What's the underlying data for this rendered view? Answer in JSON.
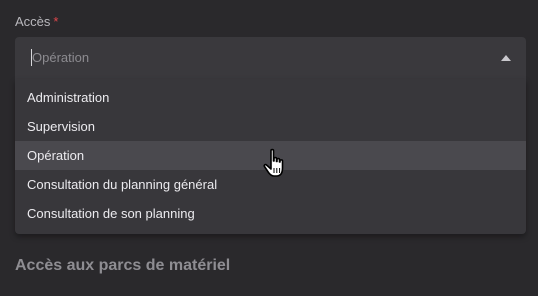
{
  "field": {
    "label": "Accès",
    "required_mark": "*",
    "placeholder": "Opération"
  },
  "dropdown": {
    "options": [
      {
        "label": "Administration"
      },
      {
        "label": "Supervision"
      },
      {
        "label": "Opération"
      },
      {
        "label": "Consultation du planning général"
      },
      {
        "label": "Consultation de son planning"
      }
    ],
    "hovered_index": 2
  },
  "section": {
    "heading": "Accès aux parcs de matériel"
  },
  "icons": {
    "dropdown_arrow": "arrow-up-icon",
    "cursor": "hand-pointer-icon"
  },
  "colors": {
    "background": "#2a292c",
    "input_background": "#3a393d",
    "menu_background": "#38373b",
    "hover_background": "#4a494e",
    "required": "#e0474c"
  }
}
